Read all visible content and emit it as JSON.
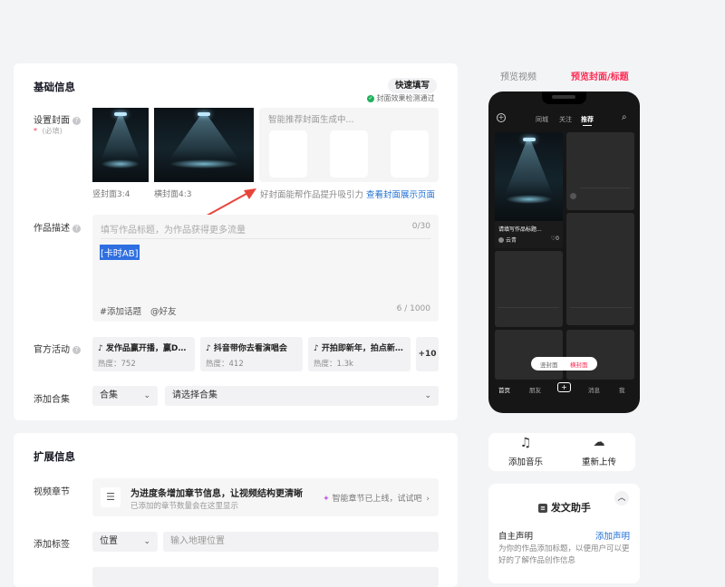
{
  "basic": {
    "title": "基础信息",
    "quick_fill": "快速填写",
    "cover_check": "封面效果检测通过",
    "cover_label": "设置封面",
    "required_mark": "*",
    "required_text": "(必填)",
    "vertical_cover": "竖封面3:4",
    "horizontal_cover": "横封面4:3",
    "ai_generating": "智能推荐封面生成中...",
    "cover_hint": "好封面能帮作品提升吸引力",
    "view_cover_page": "查看封面展示页面",
    "desc_label": "作品描述",
    "desc_placeholder": "填写作品标题，为作品获得更多流量",
    "desc_count": "0/30",
    "desc_value": "[卡时AB]",
    "hashtag_btn": "#添加话题",
    "mention_btn": "@好友",
    "body_count": "6 / 1000",
    "activity_label": "官方活动",
    "activities": [
      {
        "title": "发作品赢开播，赢D…",
        "heat": "热度：752"
      },
      {
        "title": "抖音带你去看演唱会",
        "heat": "热度：412"
      },
      {
        "title": "开拍即新年，拍点新…",
        "heat": "热度：1.3k"
      }
    ],
    "activity_more": "+10",
    "collection_label": "添加合集",
    "collection_type": "合集",
    "collection_placeholder": "请选择合集"
  },
  "extended": {
    "title": "扩展信息",
    "chapter_label": "视频章节",
    "chapter_title": "为进度条增加章节信息，让视频结构更清晰",
    "chapter_sub": "已添加的章节数量会在这里显示",
    "smart_chapter": "智能章节已上线，试试吧",
    "tag_label": "添加标签",
    "tag_type": "位置",
    "tag_placeholder": "输入地理位置"
  },
  "preview": {
    "tab_video": "预览视频",
    "tab_cover": "预览封面/标题",
    "accent_color": "#fe2c55",
    "top_tabs": [
      "同城",
      "关注",
      "推荐"
    ],
    "card_title": "请填写作品标题...",
    "card_user": "云青",
    "card_likes": "0",
    "toggle_vertical": "竖封面",
    "toggle_horizontal": "横封面",
    "bottom_nav": [
      "首页",
      "朋友",
      "+",
      "消息",
      "我"
    ]
  },
  "actions": {
    "music": "添加音乐",
    "reupload": "重新上传"
  },
  "assistant": {
    "title": "发文助手",
    "declare_label": "自主声明",
    "declare_link": "添加声明",
    "declare_desc": "为你的作品添加标题，以便用户可以更好的了解作品创作信息"
  }
}
